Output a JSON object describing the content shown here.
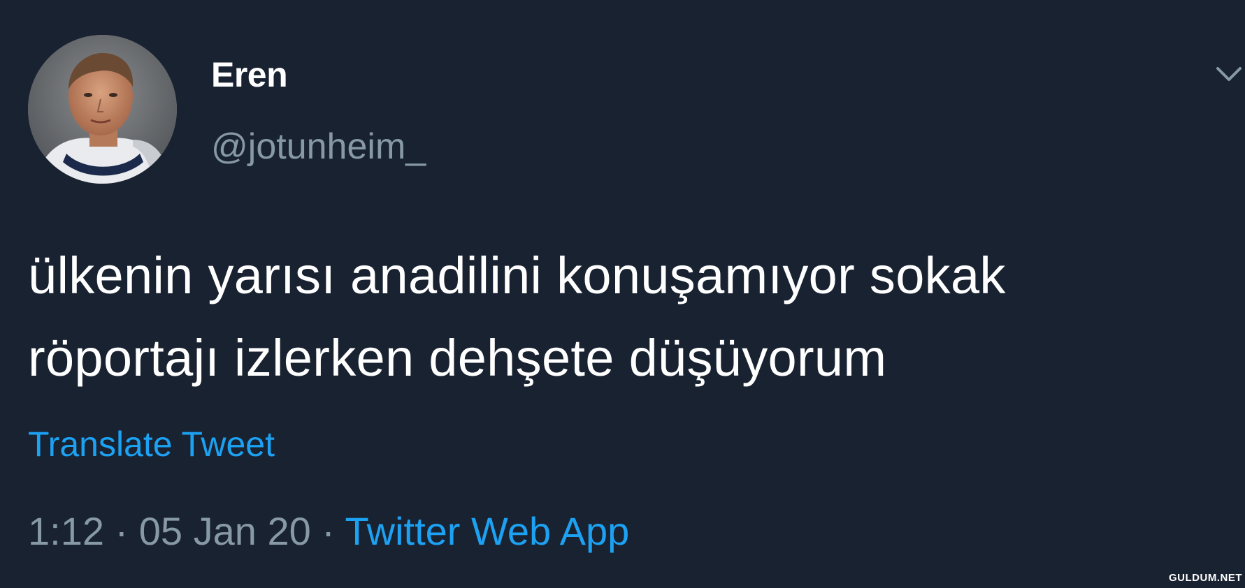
{
  "user": {
    "display_name": "Eren",
    "handle": "@jotunheim_"
  },
  "tweet": {
    "text_line1": "ülkenin yarısı anadilini konuşamıyor sokak",
    "text_line2": "röportajı izlerken dehşete düşüyorum",
    "translate_label": "Translate Tweet",
    "time": "1:12",
    "separator": " · ",
    "date": "05 Jan 20",
    "source": "Twitter Web App"
  },
  "icons": {
    "menu": "chevron-down-icon"
  },
  "watermark": "GULDUM.NET",
  "colors": {
    "background": "#182230",
    "primary_text": "#ffffff",
    "secondary_text": "#8899a6",
    "link": "#1da1f2"
  }
}
